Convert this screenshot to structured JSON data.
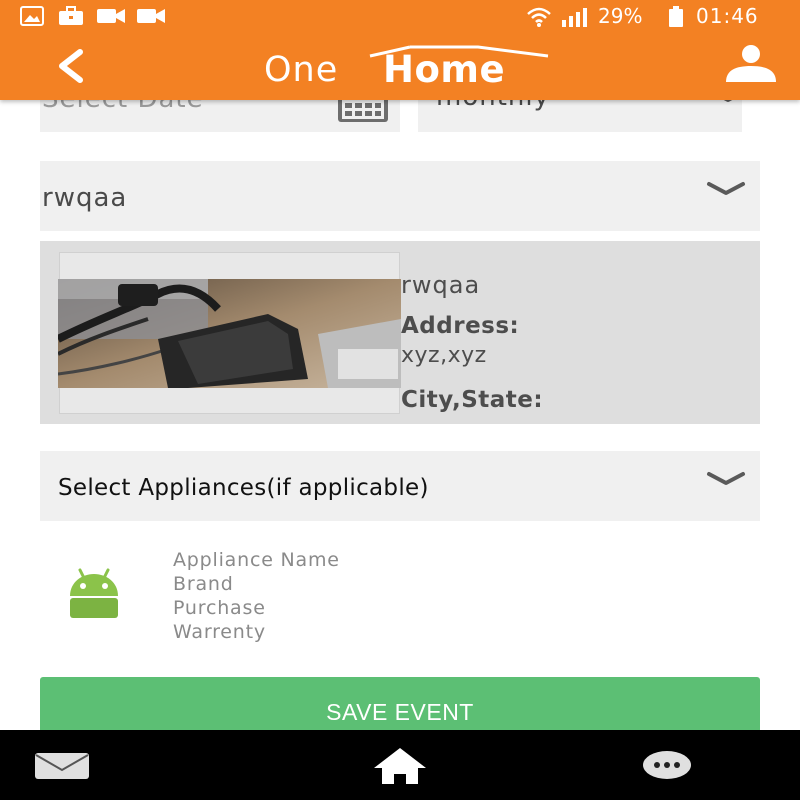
{
  "app": {
    "logo_prefix": "One",
    "logo_main": "Home",
    "brand_color": "#f38123",
    "accent_green": "#5cbf74"
  },
  "status_bar": {
    "battery_percent": "29%",
    "time": "01:46",
    "icons": [
      "image-icon",
      "briefcase-icon",
      "video-icon",
      "video-icon",
      "wifi-icon",
      "signal-icon",
      "battery-icon"
    ]
  },
  "form": {
    "date_placeholder": "Select Date",
    "frequency_value": "monthly",
    "home_selected": "rwqaa",
    "appliance_placeholder": "Select Appliances(if applicable)"
  },
  "home_card": {
    "name": "rwqaa",
    "address_label": "Address:",
    "address_value": "xyz,xyz",
    "city_state_label": "City,State:"
  },
  "appliance": {
    "name_label": "Appliance Name",
    "brand_label": "Brand",
    "purchase_label": "Purchase",
    "warranty_label": "Warrenty"
  },
  "actions": {
    "save_label": "SAVE EVENT"
  },
  "nav": {
    "icons": [
      "mail-icon",
      "home-icon",
      "more-icon"
    ]
  }
}
